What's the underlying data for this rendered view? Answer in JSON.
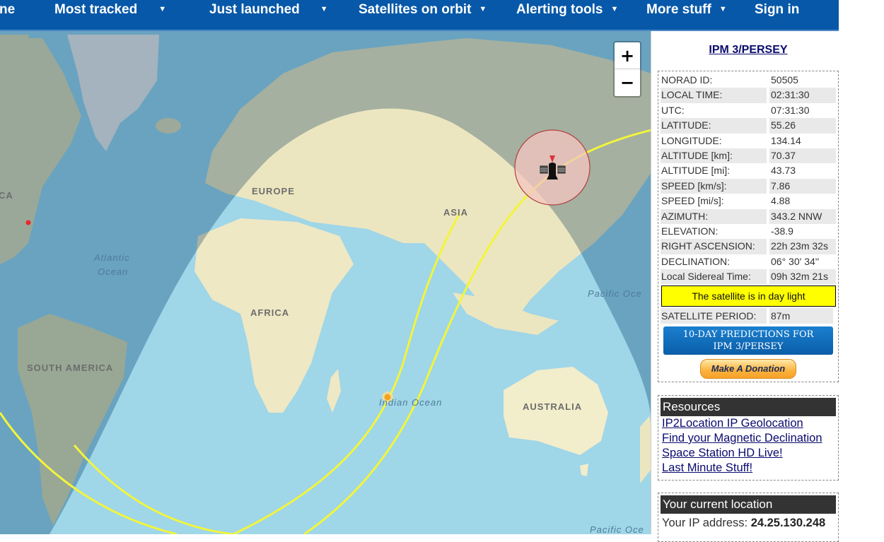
{
  "nav": {
    "items": [
      {
        "label": "ne",
        "caret": false
      },
      {
        "label": "Most tracked",
        "caret": true
      },
      {
        "label": "Just launched",
        "caret": true
      },
      {
        "label": "Satellites on orbit",
        "caret": true
      },
      {
        "label": "Alerting tools",
        "caret": true
      },
      {
        "label": "More stuff",
        "caret": true
      },
      {
        "label": "Sign in",
        "caret": false
      }
    ],
    "caret_glyph": "▼"
  },
  "map": {
    "zoom_in_label": "+",
    "zoom_out_label": "−",
    "continent_labels": [
      "EUROPE",
      "ASIA",
      "AFRICA",
      "SOUTH AMERICA",
      "AUSTRALIA",
      "CA"
    ],
    "ocean_labels": {
      "atlantic_line1": "Atlantic",
      "atlantic_line2": "Ocean",
      "indian": "Indian Ocean",
      "pacific_1": "Pacific Oce",
      "pacific_2": "Pacific Oce"
    },
    "colors": {
      "track": "#f2f53c",
      "footprint_fill": "#f4c6c0",
      "footprint_stroke": "#b04040",
      "sun": "#f7a21b",
      "user_location": "#e8282a"
    }
  },
  "sidebar": {
    "satellite_name": "IPM 3/PERSEY",
    "info": [
      {
        "key": "NORAD ID:",
        "value": "50505"
      },
      {
        "key": "LOCAL TIME:",
        "value": "02:31:30"
      },
      {
        "key": "UTC:",
        "value": "07:31:30"
      },
      {
        "key": "LATITUDE:",
        "value": "55.26"
      },
      {
        "key": "LONGITUDE:",
        "value": "134.14"
      },
      {
        "key": "ALTITUDE [km]:",
        "value": "70.37"
      },
      {
        "key": "ALTITUDE [mi]:",
        "value": "43.73"
      },
      {
        "key": "SPEED [km/s]:",
        "value": "7.86"
      },
      {
        "key": "SPEED [mi/s]:",
        "value": "4.88"
      },
      {
        "key": "AZIMUTH:",
        "value": "343.2 NNW"
      },
      {
        "key": "ELEVATION:",
        "value": "-38.9"
      },
      {
        "key": "RIGHT ASCENSION:",
        "value": "22h 23m 32s"
      },
      {
        "key": "DECLINATION:",
        "value": "06° 30' 34''"
      },
      {
        "key": "Local Sidereal Time:",
        "value": "09h 32m 21s"
      }
    ],
    "daylight_status": "The satellite is in day light",
    "period": {
      "key": "SATELLITE PERIOD:",
      "value": "87m"
    },
    "predict_button_line1": "10-DAY PREDICTIONS FOR",
    "predict_button_line2": "IPM 3/PERSEY",
    "donate_label": "Make A Donation",
    "resources": {
      "title": "Resources",
      "links": [
        "IP2Location IP Geolocation",
        "Find your Magnetic Declination",
        "Space Station HD Live!",
        "Last Minute Stuff!"
      ]
    },
    "location": {
      "title": "Your current location",
      "ip_label": "Your IP address:",
      "ip_value": "24.25.130.248"
    }
  }
}
